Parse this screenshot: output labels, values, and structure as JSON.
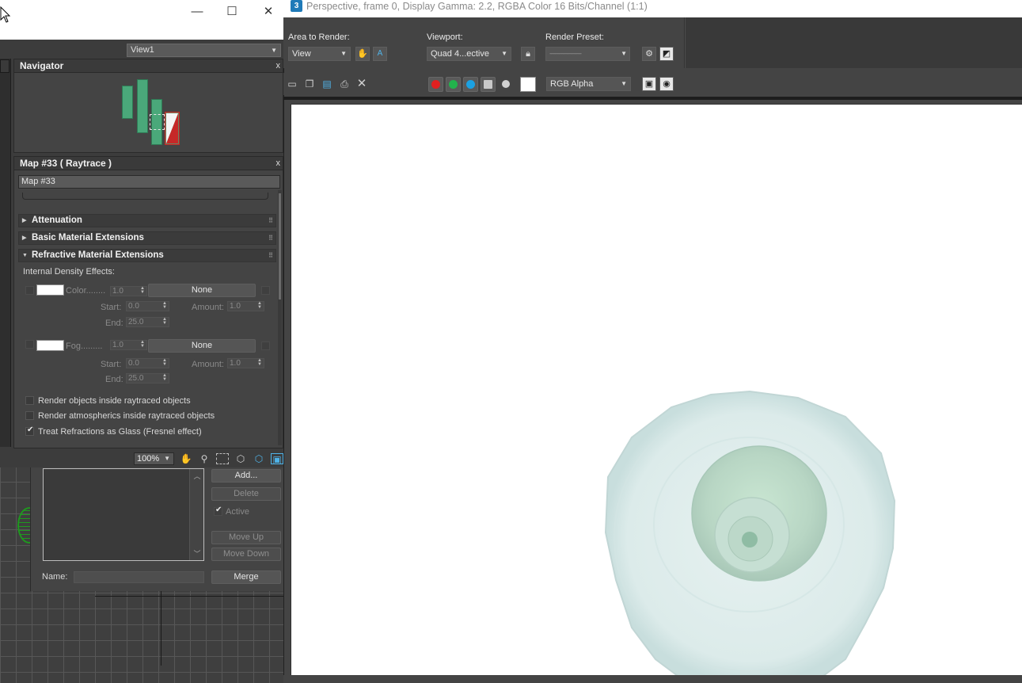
{
  "left_window": {
    "controls": {
      "minimize": "—",
      "maximize": "☐",
      "close": "✕"
    },
    "view_dropdown": "View1"
  },
  "navigator": {
    "title": "Navigator",
    "close": "x"
  },
  "map_panel": {
    "title": "Map #33  ( Raytrace )",
    "close": "x",
    "name_field": "Map #33",
    "rollouts": {
      "attenuation": "Attenuation",
      "basic_ext": "Basic Material Extensions",
      "refractive_ext": "Refractive Material Extensions"
    },
    "internal_density_label": "Internal Density Effects:",
    "color_row": {
      "label": "Color........",
      "value": "1.0",
      "map_button": "None",
      "start_label": "Start:",
      "start_value": "0.0",
      "end_label": "End:",
      "end_value": "25.0",
      "amount_label": "Amount:",
      "amount_value": "1.0"
    },
    "fog_row": {
      "label": "Fog.........",
      "value": "1.0",
      "map_button": "None",
      "start_label": "Start:",
      "start_value": "0.0",
      "end_label": "End:",
      "end_value": "25.0",
      "amount_label": "Amount:",
      "amount_value": "1.0"
    },
    "options": [
      {
        "label": "Render objects inside raytraced objects",
        "checked": false
      },
      {
        "label": "Render atmospherics inside raytraced objects",
        "checked": false
      },
      {
        "label": "Treat Refractions as Glass (Fresnel effect)",
        "checked": true
      }
    ]
  },
  "zoom_toolbar": {
    "zoom": "100%"
  },
  "state_dialog": {
    "buttons": {
      "add": "Add...",
      "delete": "Delete",
      "active": "Active",
      "move_up": "Move Up",
      "move_down": "Move Down",
      "merge": "Merge"
    },
    "name_label": "Name:",
    "active_checked": true
  },
  "render_window": {
    "title_icon": "3",
    "title": "Perspective, frame 0, Display Gamma: 2.2, RGBA Color 16 Bits/Channel (1:1)",
    "area_label": "Area to Render:",
    "area_value": "View",
    "viewport_label": "Viewport:",
    "viewport_value": "Quad 4...ective",
    "preset_label": "Render Preset:",
    "preset_value": "------------------------",
    "channel_display": "RGB Alpha",
    "channel_colors": {
      "red": "#e02020",
      "green": "#22b24c",
      "blue": "#1ba1e2"
    },
    "icons": [
      "hand-icon",
      "auto-region-icon",
      "lock-icon",
      "render-setup-icon",
      "environment-icon",
      "save-icon",
      "copy-icon",
      "clone-icon",
      "print-icon",
      "clear-icon",
      "display-toggle-icon",
      "render-toggle-icon"
    ]
  },
  "colors": {
    "ui_bg": "#444444",
    "panel_dark": "#3a3a3a",
    "render_bg": "#ffffff",
    "glass_tint": "#cfe4e2"
  }
}
